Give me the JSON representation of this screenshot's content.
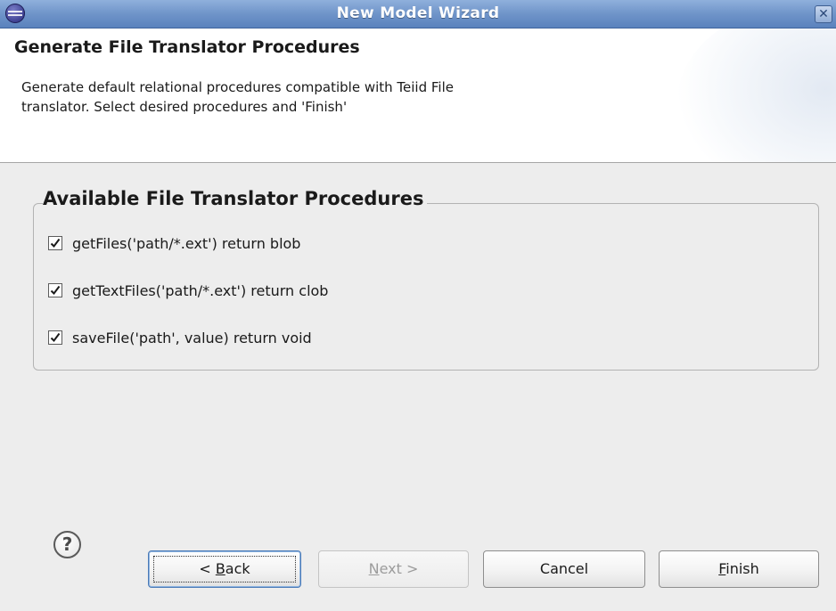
{
  "window": {
    "title": "New Model Wizard",
    "app_icon": "eclipse-icon",
    "close_glyph": "✕"
  },
  "header": {
    "title": "Generate File Translator Procedures",
    "description_line1": "Generate default relational procedures compatible with Teiid File",
    "description_line2": "translator. Select desired procedures and 'Finish'"
  },
  "group": {
    "label": "Available File Translator Procedures",
    "options": [
      {
        "label": "getFiles('path/*.ext') return blob",
        "checked": true
      },
      {
        "label": "getTextFiles('path/*.ext') return clob",
        "checked": true
      },
      {
        "label": "saveFile('path', value) return void",
        "checked": true
      }
    ]
  },
  "footer": {
    "help_glyph": "?",
    "back": {
      "prefix": "< ",
      "mnemonic": "B",
      "rest": "ack",
      "enabled": true
    },
    "next": {
      "mnemonic": "N",
      "rest": "ext >",
      "enabled": false
    },
    "cancel": {
      "label": "Cancel",
      "enabled": true
    },
    "finish": {
      "mnemonic": "F",
      "rest": "inish",
      "enabled": true
    }
  },
  "colors": {
    "titlebar": "#6f94c9",
    "dialog_bg": "#ededed",
    "header_bg": "#ffffff",
    "focus_border": "#4a7ab7"
  }
}
